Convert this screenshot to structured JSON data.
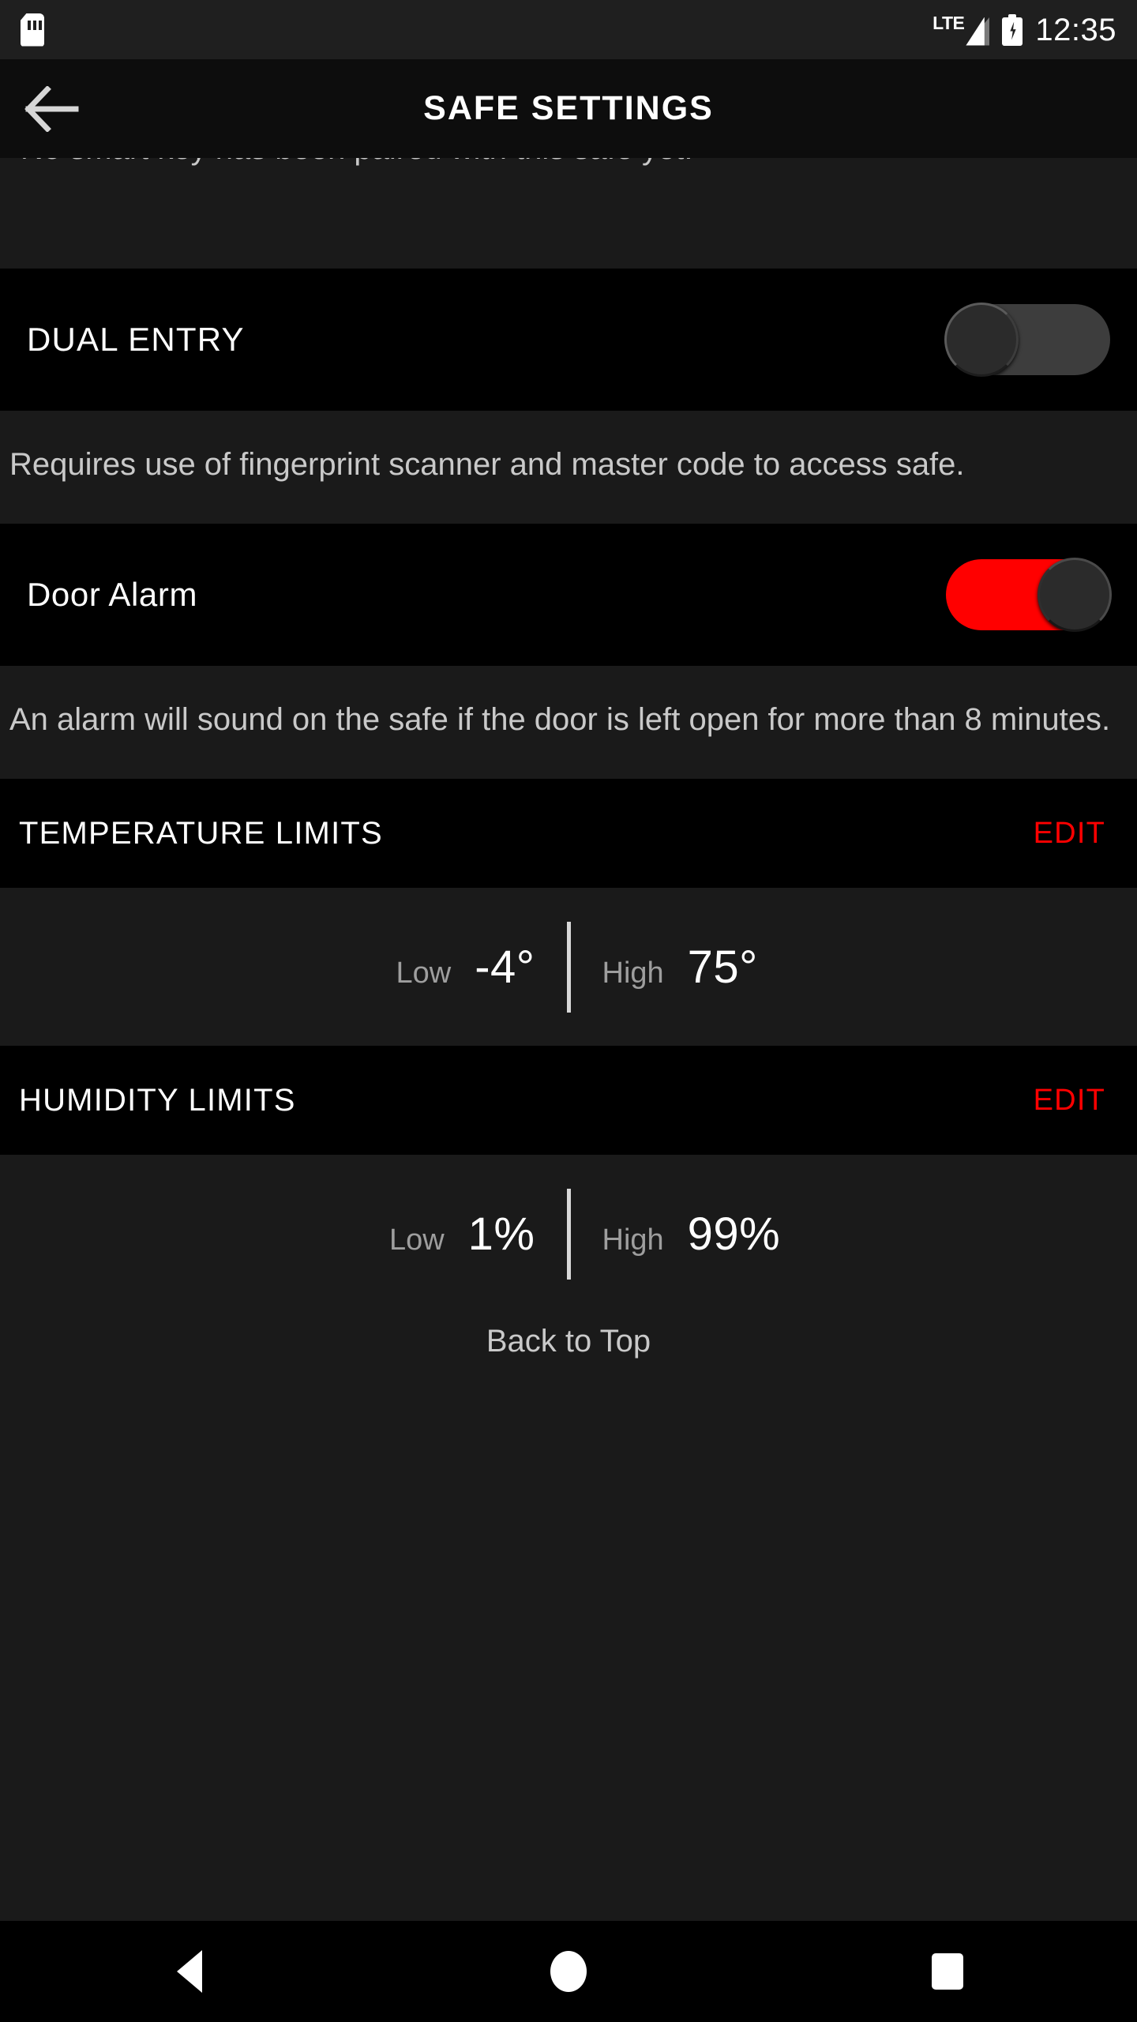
{
  "status_bar": {
    "sd_card_icon": "sd-card-icon",
    "network_label": "LTE",
    "signal_icon": "signal-bars-icon",
    "battery_icon": "battery-charging-icon",
    "time": "12:35"
  },
  "header": {
    "back_icon": "back-arrow-icon",
    "title": "SAFE SETTINGS"
  },
  "content": {
    "clipped_text": "No smart key has been paired with this safe yet.",
    "dual_entry": {
      "label": "DUAL ENTRY",
      "toggle_state": "off",
      "description": "Requires use of fingerprint scanner and master code to access safe."
    },
    "door_alarm": {
      "label": "Door Alarm",
      "toggle_state": "on",
      "description": "An alarm will sound on the safe if the door is left open for more than 8 minutes."
    },
    "temperature_limits": {
      "title": "TEMPERATURE LIMITS",
      "edit_label": "EDIT",
      "low_key": "Low",
      "low_value": "-4°",
      "high_key": "High",
      "high_value": "75°"
    },
    "humidity_limits": {
      "title": "HUMIDITY LIMITS",
      "edit_label": "EDIT",
      "low_key": "Low",
      "low_value": "1%",
      "high_key": "High",
      "high_value": "99%"
    },
    "back_to_top": "Back to Top"
  },
  "nav_bar": {
    "back": "back-triangle-icon",
    "home": "home-circle-icon",
    "recents": "recents-square-icon"
  },
  "colors": {
    "accent_red": "#ff0000",
    "block_dark": "#1a1a1a",
    "block_black": "#000000",
    "text_primary": "#ffffff",
    "text_secondary": "#c9c9c9"
  }
}
